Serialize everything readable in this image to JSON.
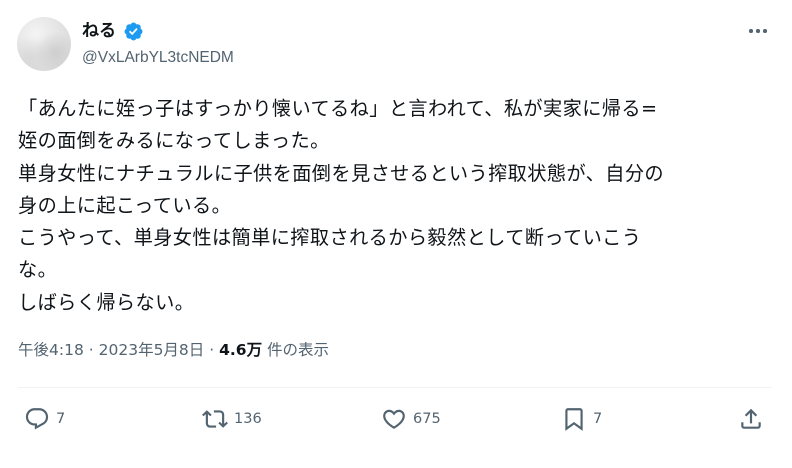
{
  "author": {
    "display_name": "ねる",
    "handle": "@VxLArbYL3tcNEDM",
    "verified": true,
    "verified_color": "#1d9bf0"
  },
  "tweet": {
    "lines": [
      "「あんたに姪っ子はすっかり懐いてるね」と言われて、私が実家に帰る=",
      "姪の面倒をみるになってしまった。",
      "単身女性にナチュラルに子供を面倒を見させるという搾取状態が、自分の",
      "身の上に起こっている。",
      "こうやって、単身女性は簡単に搾取されるから毅然として断っていこう",
      "な。",
      "しばらく帰らない。"
    ]
  },
  "meta": {
    "time": "午後4:18",
    "separator": "·",
    "date": "2023年5月8日",
    "views_count": "4.6万",
    "views_label": "件の表示"
  },
  "actions": {
    "reply_count": "7",
    "retweet_count": "136",
    "like_count": "675",
    "bookmark_count": "7"
  },
  "icons": {
    "more": "more-horizontal-icon",
    "reply": "reply-bubble-icon",
    "retweet": "retweet-arrows-icon",
    "like": "heart-icon",
    "bookmark": "bookmark-icon",
    "share": "share-upload-icon"
  }
}
